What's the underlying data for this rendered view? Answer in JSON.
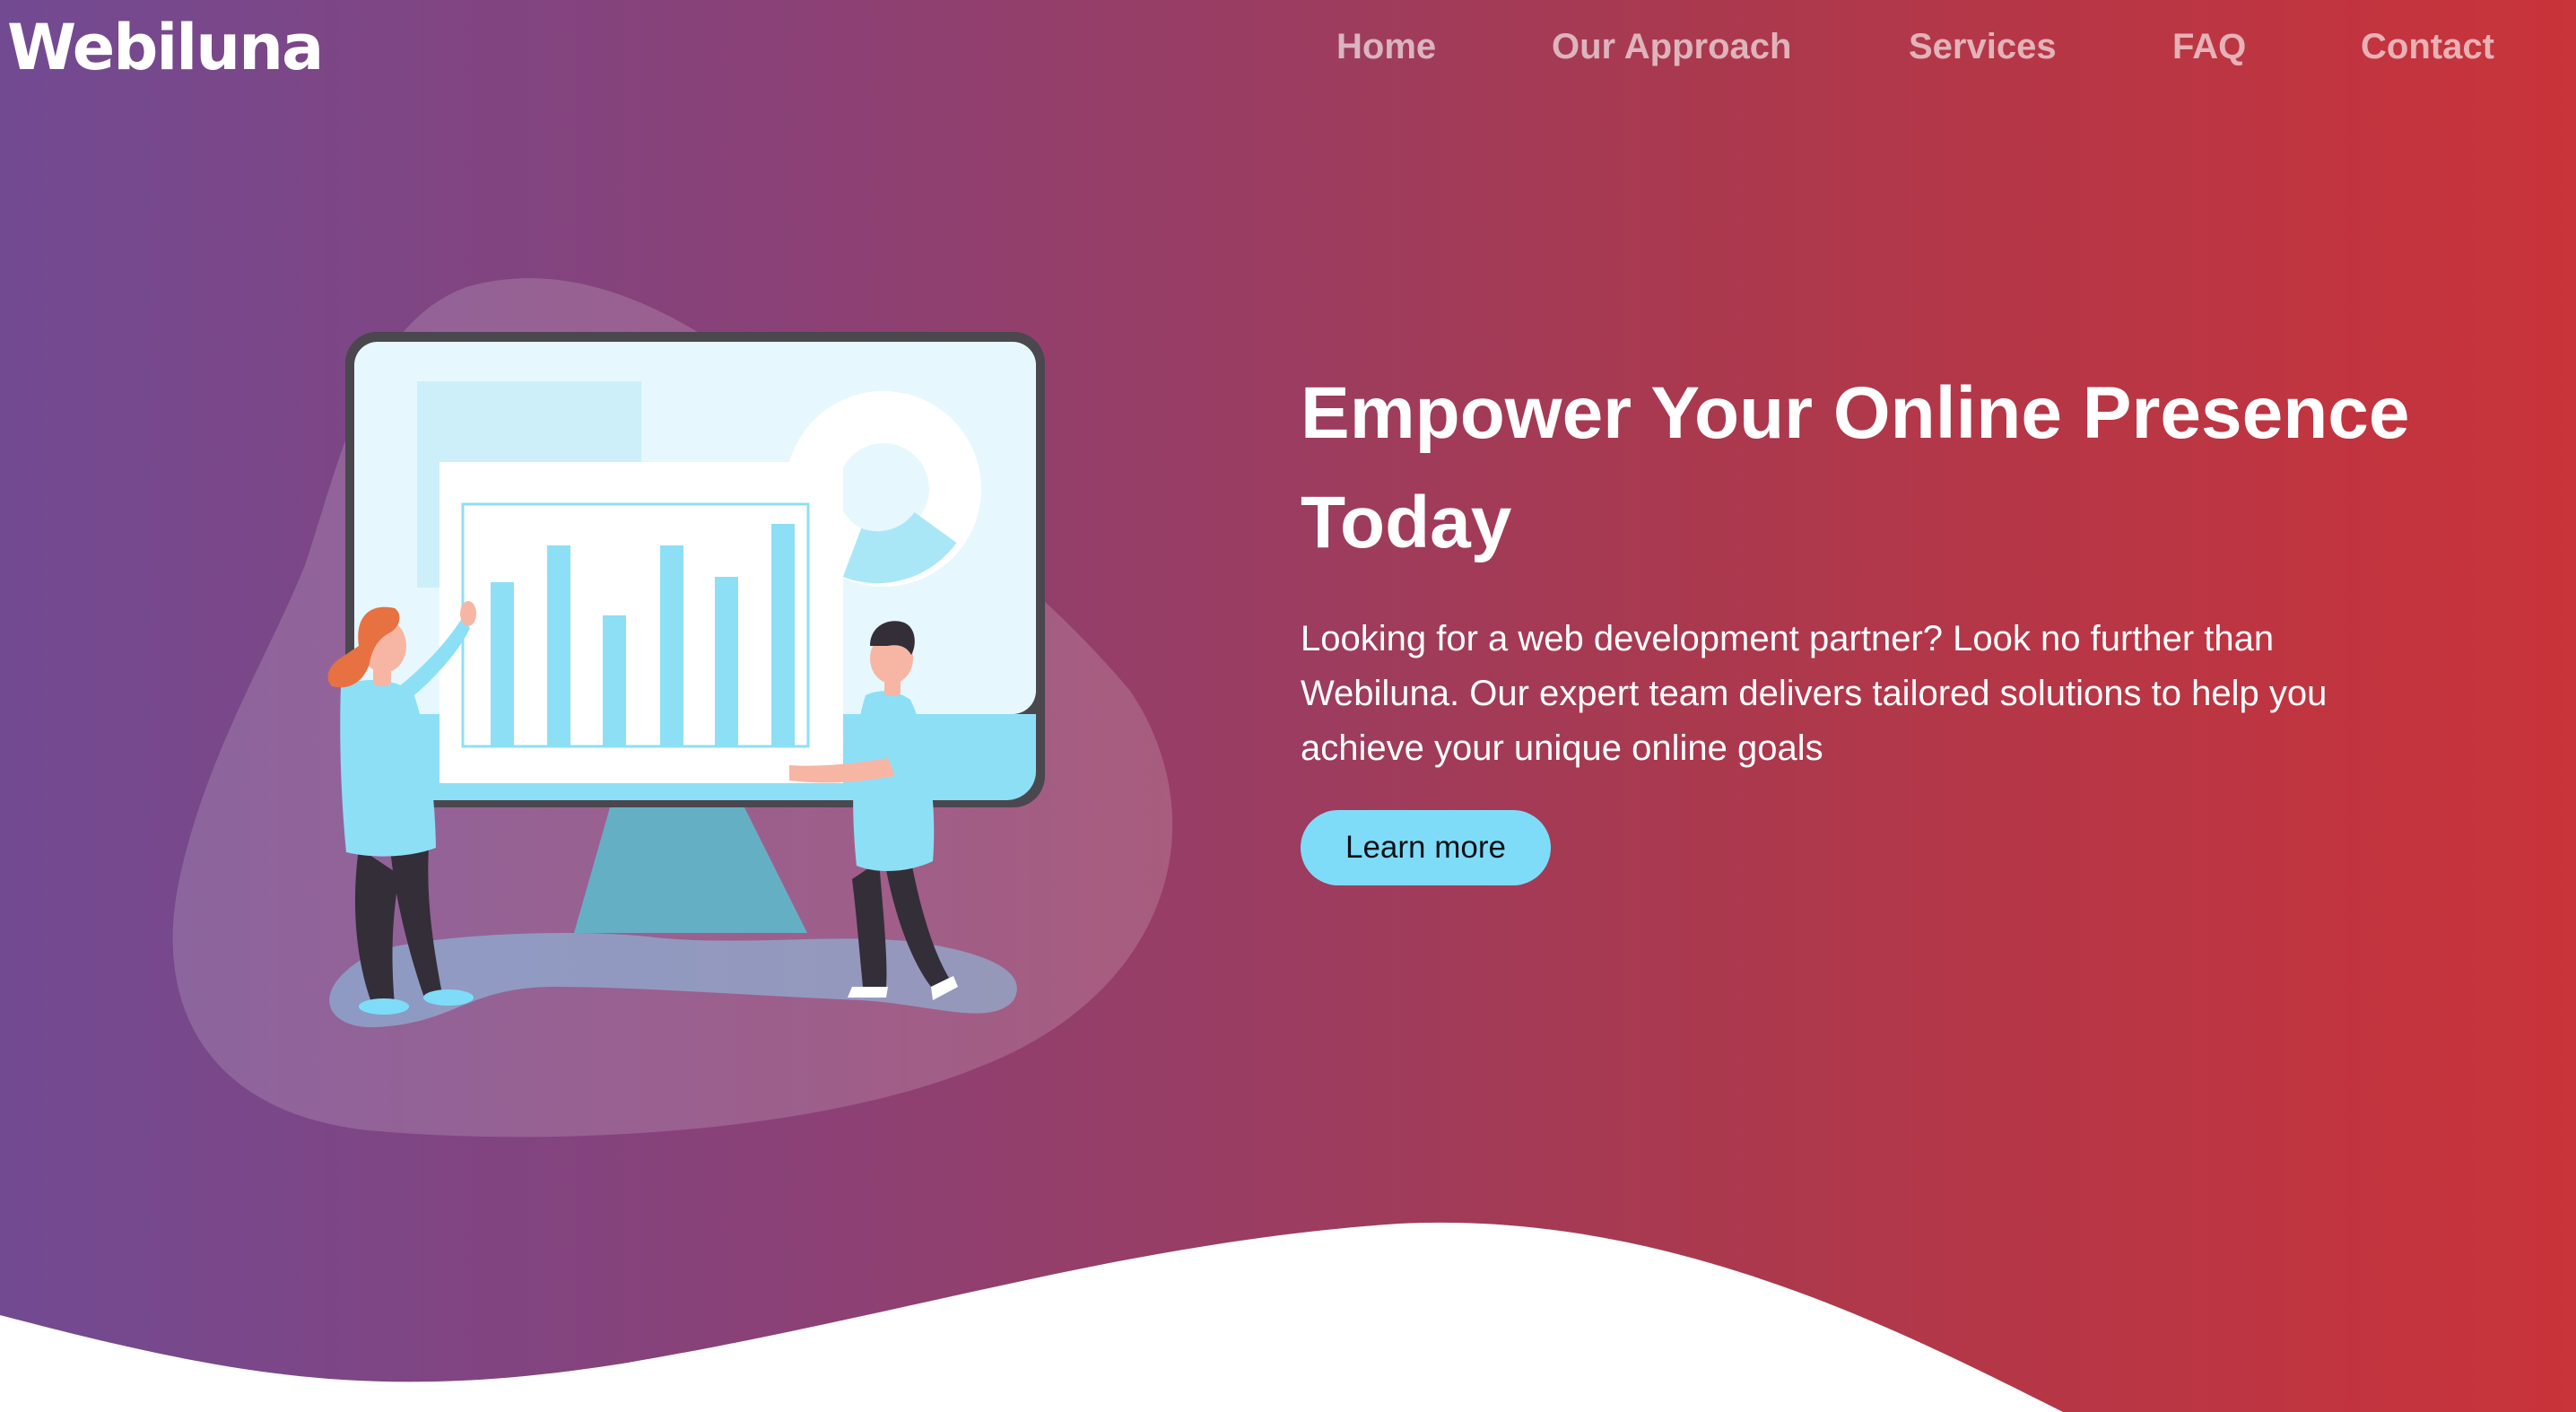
{
  "brand": {
    "logo_text": "Webiluna"
  },
  "nav": {
    "items": [
      {
        "label": "Home"
      },
      {
        "label": "Our Approach"
      },
      {
        "label": "Services"
      },
      {
        "label": "FAQ"
      },
      {
        "label": "Contact"
      }
    ]
  },
  "hero": {
    "title": "Empower Your Online Presence Today",
    "description": "Looking for a web development partner? Look no further than Webiluna. Our expert team delivers tailored solutions to help you achieve your unique online goals",
    "cta_label": "Learn more"
  },
  "colors": {
    "gradient_start": "#724a92",
    "gradient_end": "#c9333a",
    "accent": "#7fdcf8"
  },
  "illustration": {
    "icon": "analytics-presentation-illustration"
  }
}
